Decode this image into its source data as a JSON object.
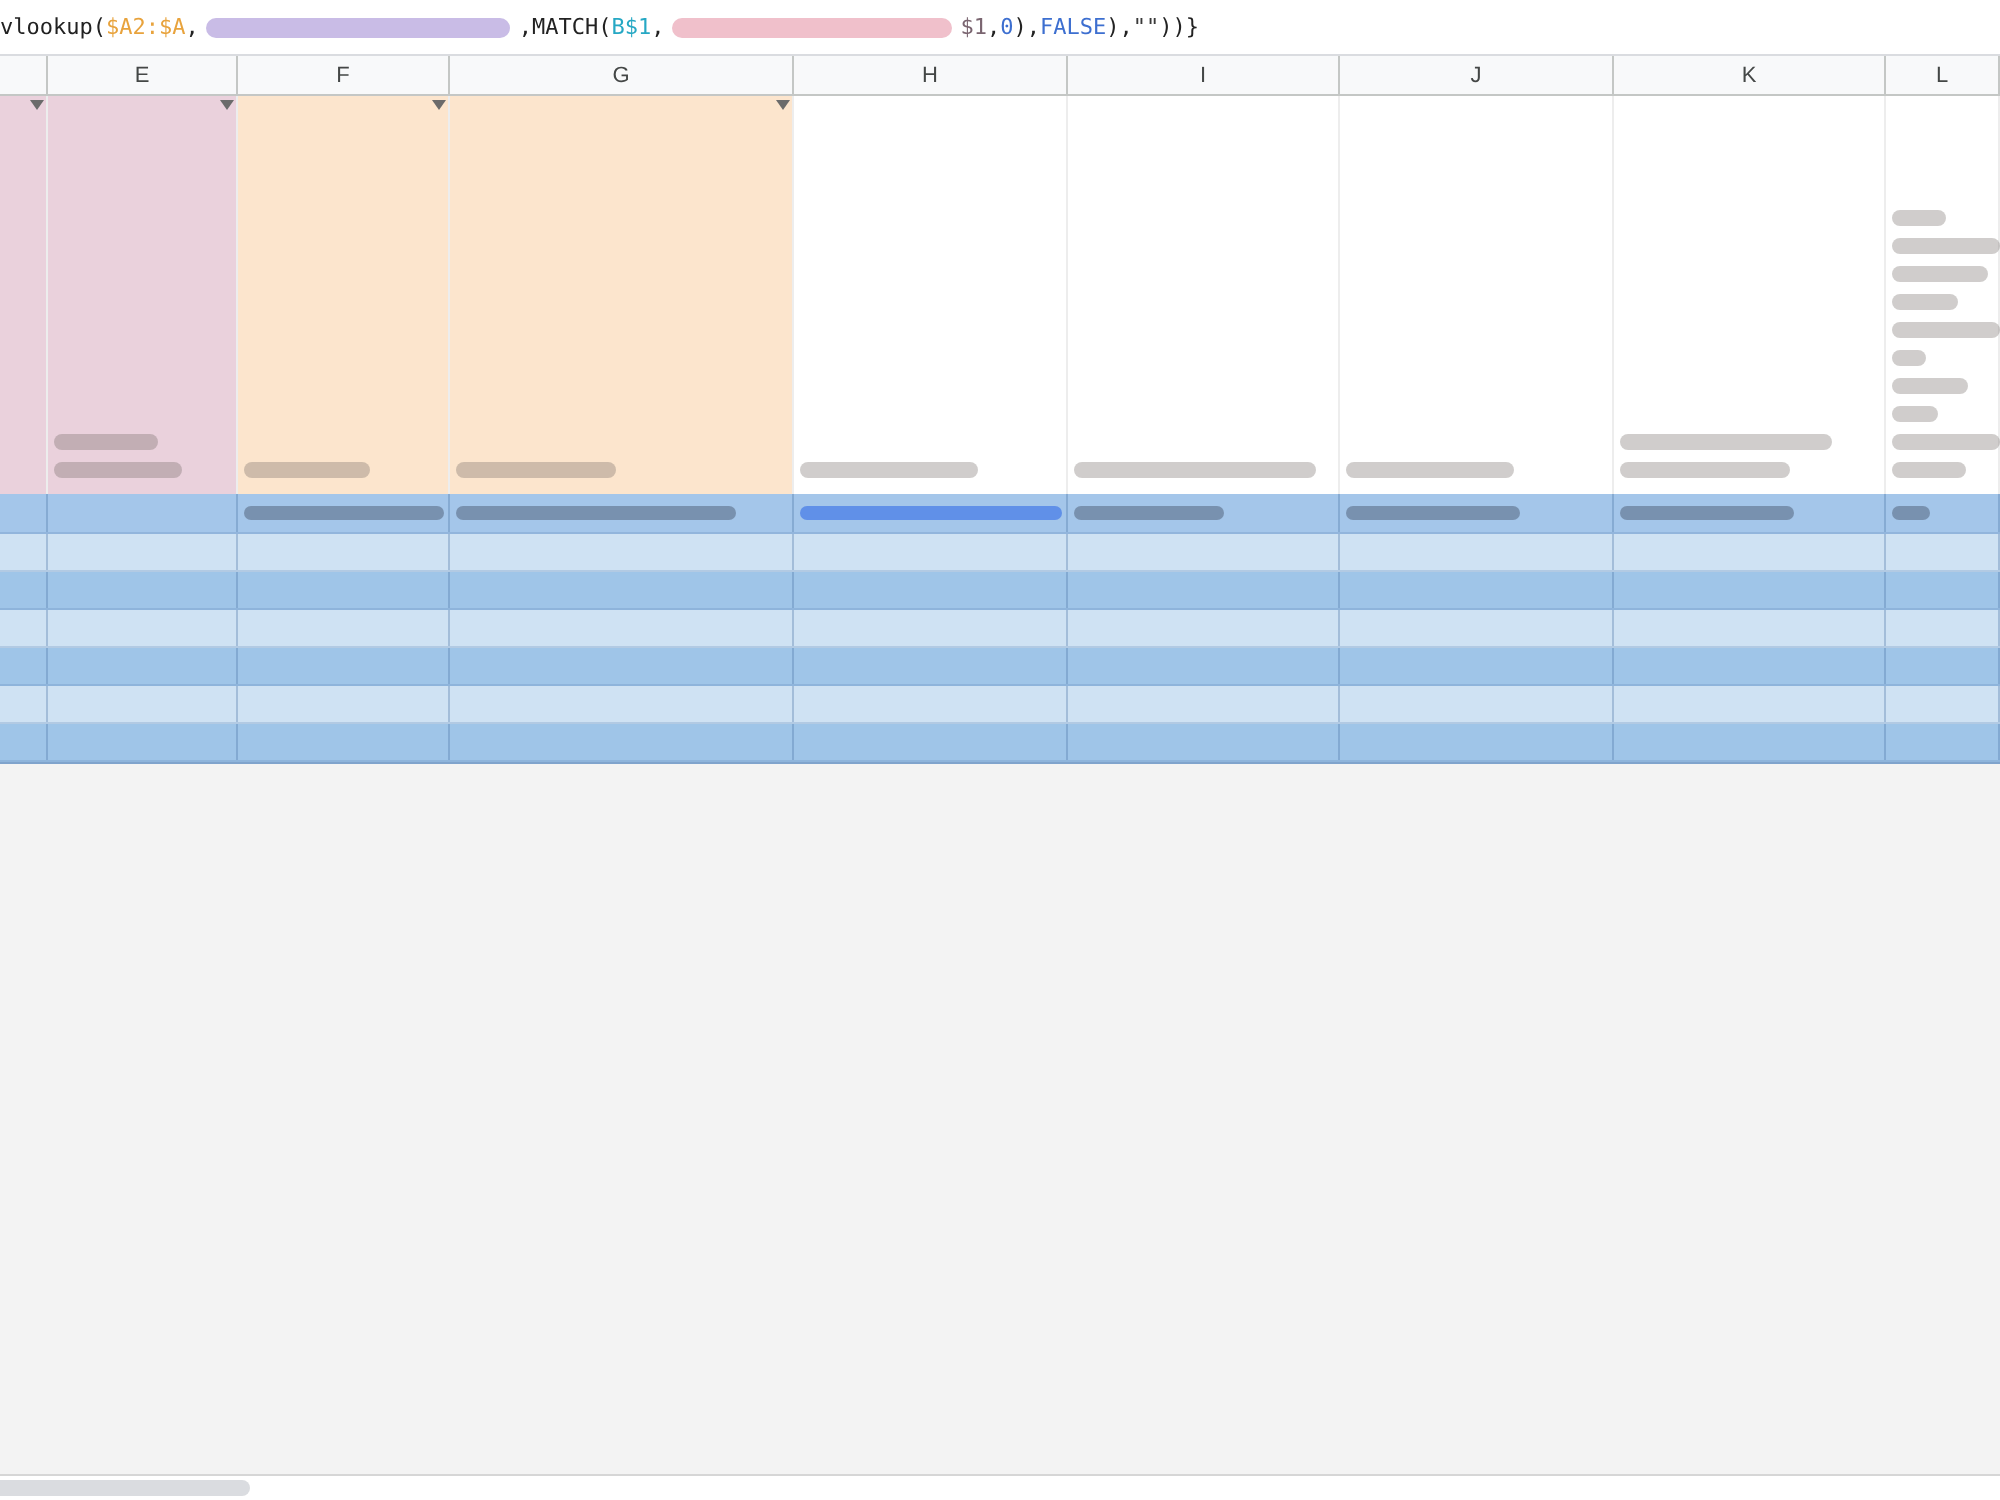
{
  "formula_bar": {
    "segments": [
      {
        "kind": "text",
        "parts": [
          {
            "text": "vlookup(",
            "color": "#222222"
          },
          {
            "text": "$A2:$A",
            "color": "#e8a33d"
          },
          {
            "text": ",",
            "color": "#222222"
          }
        ]
      },
      {
        "kind": "blurred",
        "color": "#c9bce6"
      },
      {
        "kind": "text",
        "parts": [
          {
            "text": ",MATCH(",
            "color": "#222222"
          },
          {
            "text": "B$1",
            "color": "#26a8c4"
          },
          {
            "text": ",",
            "color": "#222222"
          }
        ]
      },
      {
        "kind": "blurred",
        "color": "#f0c0cb"
      },
      {
        "kind": "text",
        "parts": [
          {
            "text": "$1",
            "color": "#7a6570"
          },
          {
            "text": ",",
            "color": "#222222"
          },
          {
            "text": "0",
            "color": "#3d6fd0"
          },
          {
            "text": "),",
            "color": "#222222"
          },
          {
            "text": "FALSE",
            "color": "#3d6fd0"
          },
          {
            "text": "),",
            "color": "#222222"
          },
          {
            "text": "\"\"",
            "color": "#3a3a3a"
          },
          {
            "text": "))}",
            "color": "#222222"
          }
        ]
      }
    ]
  },
  "column_letters": [
    "E",
    "F",
    "G",
    "H",
    "I",
    "J",
    "K",
    "L"
  ],
  "header_row": {
    "cells": [
      {
        "color": "#ead1dc",
        "filter": true,
        "kind": "empty"
      },
      {
        "color": "#ead1dc",
        "filter": true,
        "kind": "two_lines"
      },
      {
        "color": "#fce5cd",
        "filter": true,
        "kind": "line"
      },
      {
        "color": "#fce5cd",
        "filter": true,
        "kind": "line"
      },
      {
        "color": "#ffffff",
        "filter": false,
        "kind": "line"
      },
      {
        "color": "#ffffff",
        "filter": false,
        "kind": "line"
      },
      {
        "color": "#ffffff",
        "filter": false,
        "kind": "line"
      },
      {
        "color": "#ffffff",
        "filter": false,
        "kind": "two_lines"
      },
      {
        "color": "#ffffff",
        "filter": false,
        "kind": "tall"
      }
    ]
  },
  "rows": [
    {
      "color": "#a4c6ea",
      "cells": [
        {
          "kind": "empty"
        },
        {
          "kind": "empty"
        },
        {
          "kind": "text"
        },
        {
          "kind": "text"
        },
        {
          "kind": "link"
        },
        {
          "kind": "text"
        },
        {
          "kind": "text"
        },
        {
          "kind": "text"
        },
        {
          "kind": "text"
        }
      ]
    },
    {
      "color": "#cfe2f3"
    },
    {
      "color": "#9fc5e8"
    },
    {
      "color": "#cfe2f3"
    },
    {
      "color": "#9fc5e8"
    },
    {
      "color": "#cfe2f3"
    },
    {
      "color": "#9fc5e8"
    }
  ]
}
